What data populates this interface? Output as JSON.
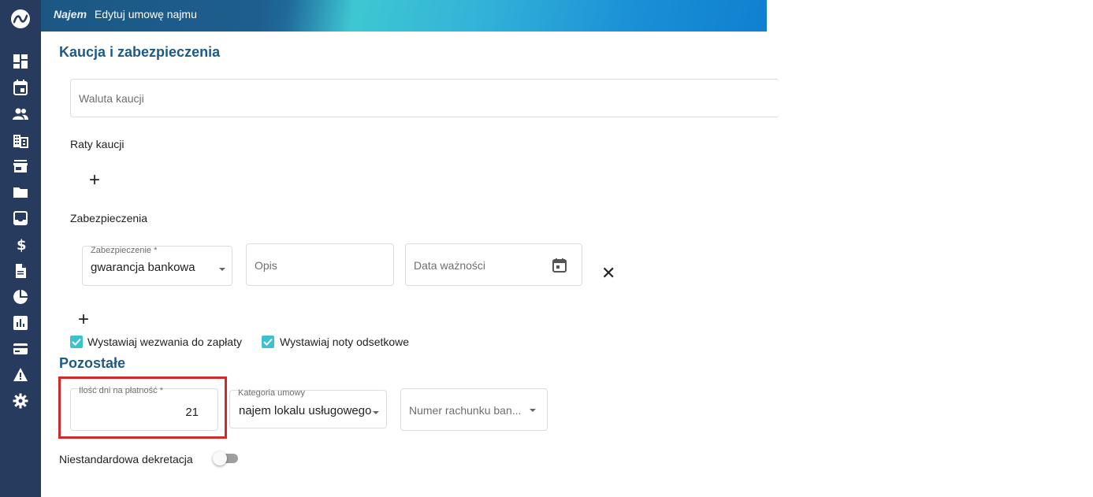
{
  "header": {
    "app_name": "Najem",
    "page_title": "Edytuj umowę najmu"
  },
  "sidebar": {
    "items": [
      {
        "icon": "dashboard-icon"
      },
      {
        "icon": "calendar-icon"
      },
      {
        "icon": "people-icon"
      },
      {
        "icon": "building-icon"
      },
      {
        "icon": "store-icon"
      },
      {
        "icon": "folder-icon"
      },
      {
        "icon": "inbox-icon"
      },
      {
        "icon": "dollar-icon"
      },
      {
        "icon": "document-icon"
      },
      {
        "icon": "pie-chart-icon"
      },
      {
        "icon": "bar-chart-icon"
      },
      {
        "icon": "credit-card-icon"
      },
      {
        "icon": "warning-icon"
      },
      {
        "icon": "settings-icon"
      }
    ]
  },
  "deposit": {
    "title": "Kaucja i zabezpieczenia",
    "currency_placeholder": "Waluta kaucji",
    "installments_label": "Raty kaucji",
    "securities_label": "Zabezpieczenia",
    "security_row": {
      "type_label": "Zabezpieczenie *",
      "type_value": "gwarancja bankowa",
      "description_placeholder": "Opis",
      "expiry_placeholder": "Data ważności"
    },
    "checkbox_payment_reminders": "Wystawiaj wezwania do zapłaty",
    "checkbox_interest_notes": "Wystawiaj noty odsetkowe"
  },
  "other": {
    "title": "Pozostałe",
    "payment_days_label": "Ilość dni na płatność *",
    "payment_days_value": "21",
    "category_label": "Kategoria umowy",
    "category_value": "najem lokalu usługowego",
    "bank_account_placeholder": "Numer rachunku ban...",
    "custom_posting_label": "Niestandardowa dekretacja",
    "custom_posting_enabled": false
  },
  "colors": {
    "sidebar": "#263b5e",
    "accent": "#1d5b86",
    "checkbox": "#3ec1cf",
    "highlight": "#d12a2a"
  }
}
